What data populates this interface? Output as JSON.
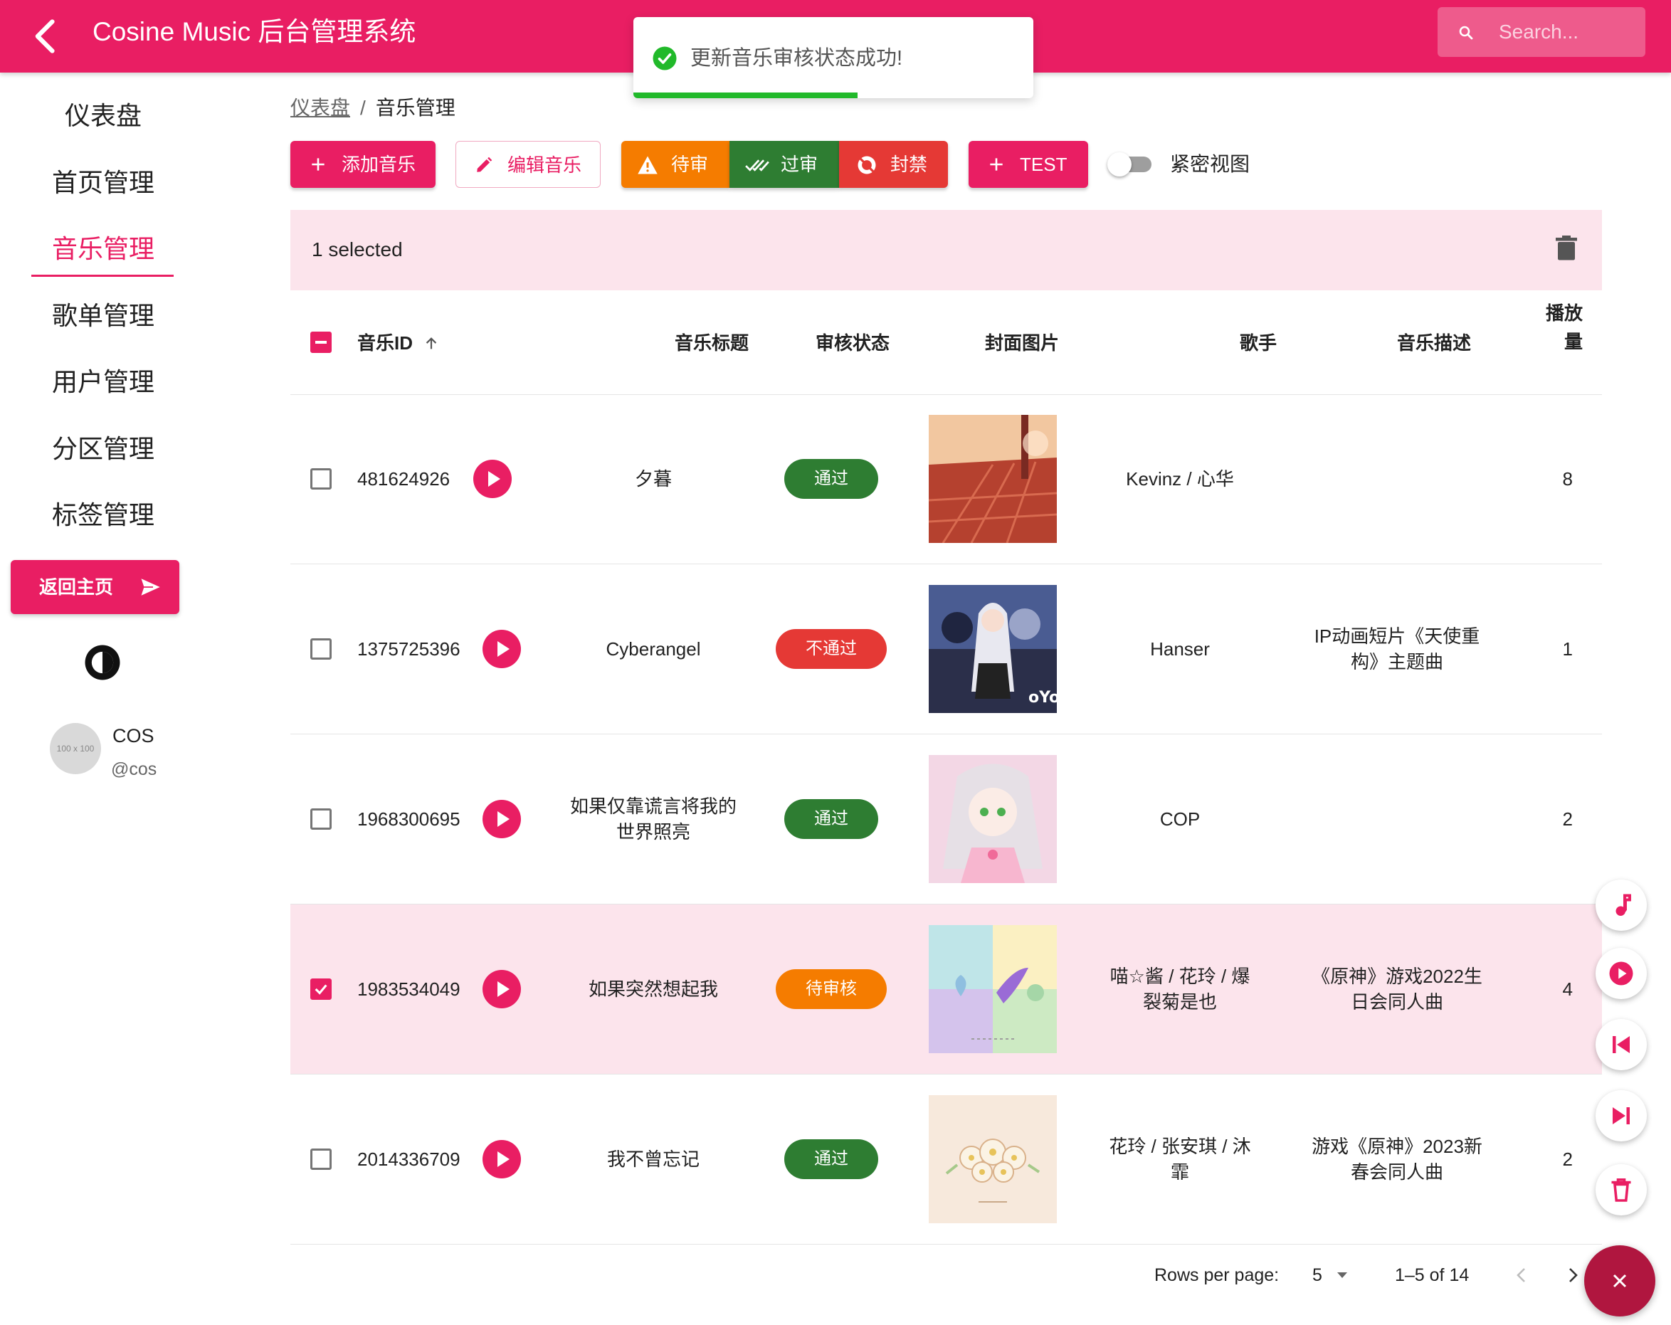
{
  "appbar": {
    "title": "Cosine Music 后台管理系统",
    "search_placeholder": "Search..."
  },
  "toast": {
    "message": "更新音乐审核状态成功!",
    "progress": 0.56
  },
  "sidebar": {
    "items": [
      {
        "label": "仪表盘",
        "active": false
      },
      {
        "label": "首页管理",
        "active": false
      },
      {
        "label": "音乐管理",
        "active": true
      },
      {
        "label": "歌单管理",
        "active": false
      },
      {
        "label": "用户管理",
        "active": false
      },
      {
        "label": "分区管理",
        "active": false
      },
      {
        "label": "标签管理",
        "active": false
      }
    ],
    "home_button": "返回主页",
    "user": {
      "avatar_text": "100 x 100",
      "name": "COS",
      "handle": "@cos"
    }
  },
  "breadcrumb": {
    "parent": "仪表盘",
    "separator": "/",
    "current": "音乐管理"
  },
  "toolbar": {
    "add": "添加音乐",
    "edit": "编辑音乐",
    "pending": "待审",
    "approve": "过审",
    "ban": "封禁",
    "test": "TEST",
    "dense_label": "紧密视图",
    "dense_on": false
  },
  "colors": {
    "primary": "#e91e63",
    "pending": "#f57c00",
    "approved": "#2e7d32",
    "rejected": "#e53935"
  },
  "selection": {
    "text": "1 selected"
  },
  "table": {
    "headers": {
      "id": "音乐ID",
      "title": "音乐标题",
      "status": "审核状态",
      "cover": "封面图片",
      "artist": "歌手",
      "desc": "音乐描述",
      "plays_line1": "播放",
      "plays_line2": "量"
    },
    "rows": [
      {
        "id": "481624926",
        "title": [
          "夕暮"
        ],
        "status": "通过",
        "status_color": "#2e7d32",
        "artist": [
          "Kevinz / 心华"
        ],
        "desc": [],
        "plays": "8",
        "selected": false
      },
      {
        "id": "1375725396",
        "title": [
          "Cyberangel"
        ],
        "status": "不通过",
        "status_color": "#e53935",
        "artist": [
          "Hanser"
        ],
        "desc": [
          "IP动画短片《天使重",
          "构》主题曲"
        ],
        "plays": "1",
        "selected": false
      },
      {
        "id": "1968300695",
        "title": [
          "如果仅靠谎言将我的",
          "世界照亮"
        ],
        "status": "通过",
        "status_color": "#2e7d32",
        "artist": [
          "COP"
        ],
        "desc": [],
        "plays": "2",
        "selected": false
      },
      {
        "id": "1983534049",
        "title": [
          "如果突然想起我"
        ],
        "status": "待审核",
        "status_color": "#f57c00",
        "artist": [
          "喵☆酱 / 花玲 / 爆",
          "裂菊是也"
        ],
        "desc": [
          "《原神》游戏2022生",
          "日会同人曲"
        ],
        "plays": "4",
        "selected": true
      },
      {
        "id": "2014336709",
        "title": [
          "我不曾忘记"
        ],
        "status": "通过",
        "status_color": "#2e7d32",
        "artist": [
          "花玲 / 张安琪 / 沐",
          "霏"
        ],
        "desc": [
          "游戏《原神》2023新",
          "春会同人曲"
        ],
        "plays": "2",
        "selected": false
      }
    ]
  },
  "pagination": {
    "rows_per_page_label": "Rows per page:",
    "rows_per_page": "5",
    "range": "1–5 of 14"
  },
  "fabs": [
    "music-note-icon",
    "play-icon",
    "skip-previous-icon",
    "skip-next-icon",
    "delete-icon",
    "close-icon"
  ]
}
